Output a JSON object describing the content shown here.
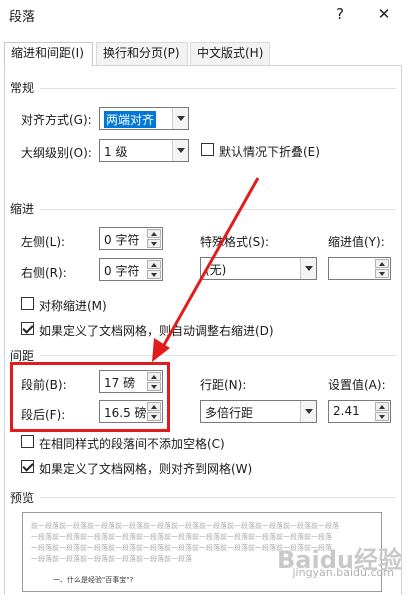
{
  "window": {
    "title": "段落",
    "help_label": "?",
    "close_label": "✕"
  },
  "tabs": [
    {
      "label": "缩进和间距(I)",
      "active": true
    },
    {
      "label": "换行和分页(P)",
      "active": false
    },
    {
      "label": "中文版式(H)",
      "active": false
    }
  ],
  "general": {
    "title": "常规",
    "alignment_label": "对齐方式(G):",
    "alignment_value": "两端对齐",
    "outline_label": "大纲级别(O):",
    "outline_value": "1 级",
    "collapse_label": "默认情况下折叠(E)"
  },
  "indent": {
    "title": "缩进",
    "left_label": "左侧(L):",
    "left_value": "0 字符",
    "right_label": "右侧(R):",
    "right_value": "0 字符",
    "special_label": "特殊格式(S):",
    "special_value": "(无)",
    "indent_value_label": "缩进值(Y):",
    "indent_value": "",
    "mirror_label": "对称缩进(M)",
    "mirror_checked": false,
    "grid_adjust_label": "如果定义了文档网格，则自动调整右缩进(D)",
    "grid_adjust_checked": true
  },
  "spacing": {
    "title": "间距",
    "before_label": "段前(B):",
    "before_value": "17 磅",
    "after_label": "段后(F):",
    "after_value": "16.5 磅",
    "line_spacing_label": "行距(N):",
    "line_spacing_value": "多倍行距",
    "at_label": "设置值(A):",
    "at_value": "2.41",
    "no_space_label": "在相同样式的段落间不添加空格(C)",
    "no_space_checked": false,
    "snap_grid_label": "如果定义了文档网格，则对齐到网格(W)",
    "snap_grid_checked": true
  },
  "preview": {
    "title": "预览",
    "lines": [
      "前一段落前一段落前一段落前一段落前一段落前一段落前一段落前一段落前一段落前一段落前一段落",
      "一段落前一段落前一段落前一段落前一段落前一段落前一段落前一段落前一段落前一段落前一段落",
      "一段落前一段落前一段落前一段落前一段落前一段落前一段落前一段落前一段落前一段落前一段落",
      "一段落前一段落前一段落前一段落前一段落前一段落"
    ],
    "body_text": "一、什么是经验\"百事宝\"?"
  },
  "watermark": {
    "brand": "Baidu经验",
    "sub": "jingyan.baidu.com"
  },
  "colors": {
    "highlight": "#e21c1c",
    "selection": "#0078d7",
    "accent_arrow": "#e21c1c"
  }
}
